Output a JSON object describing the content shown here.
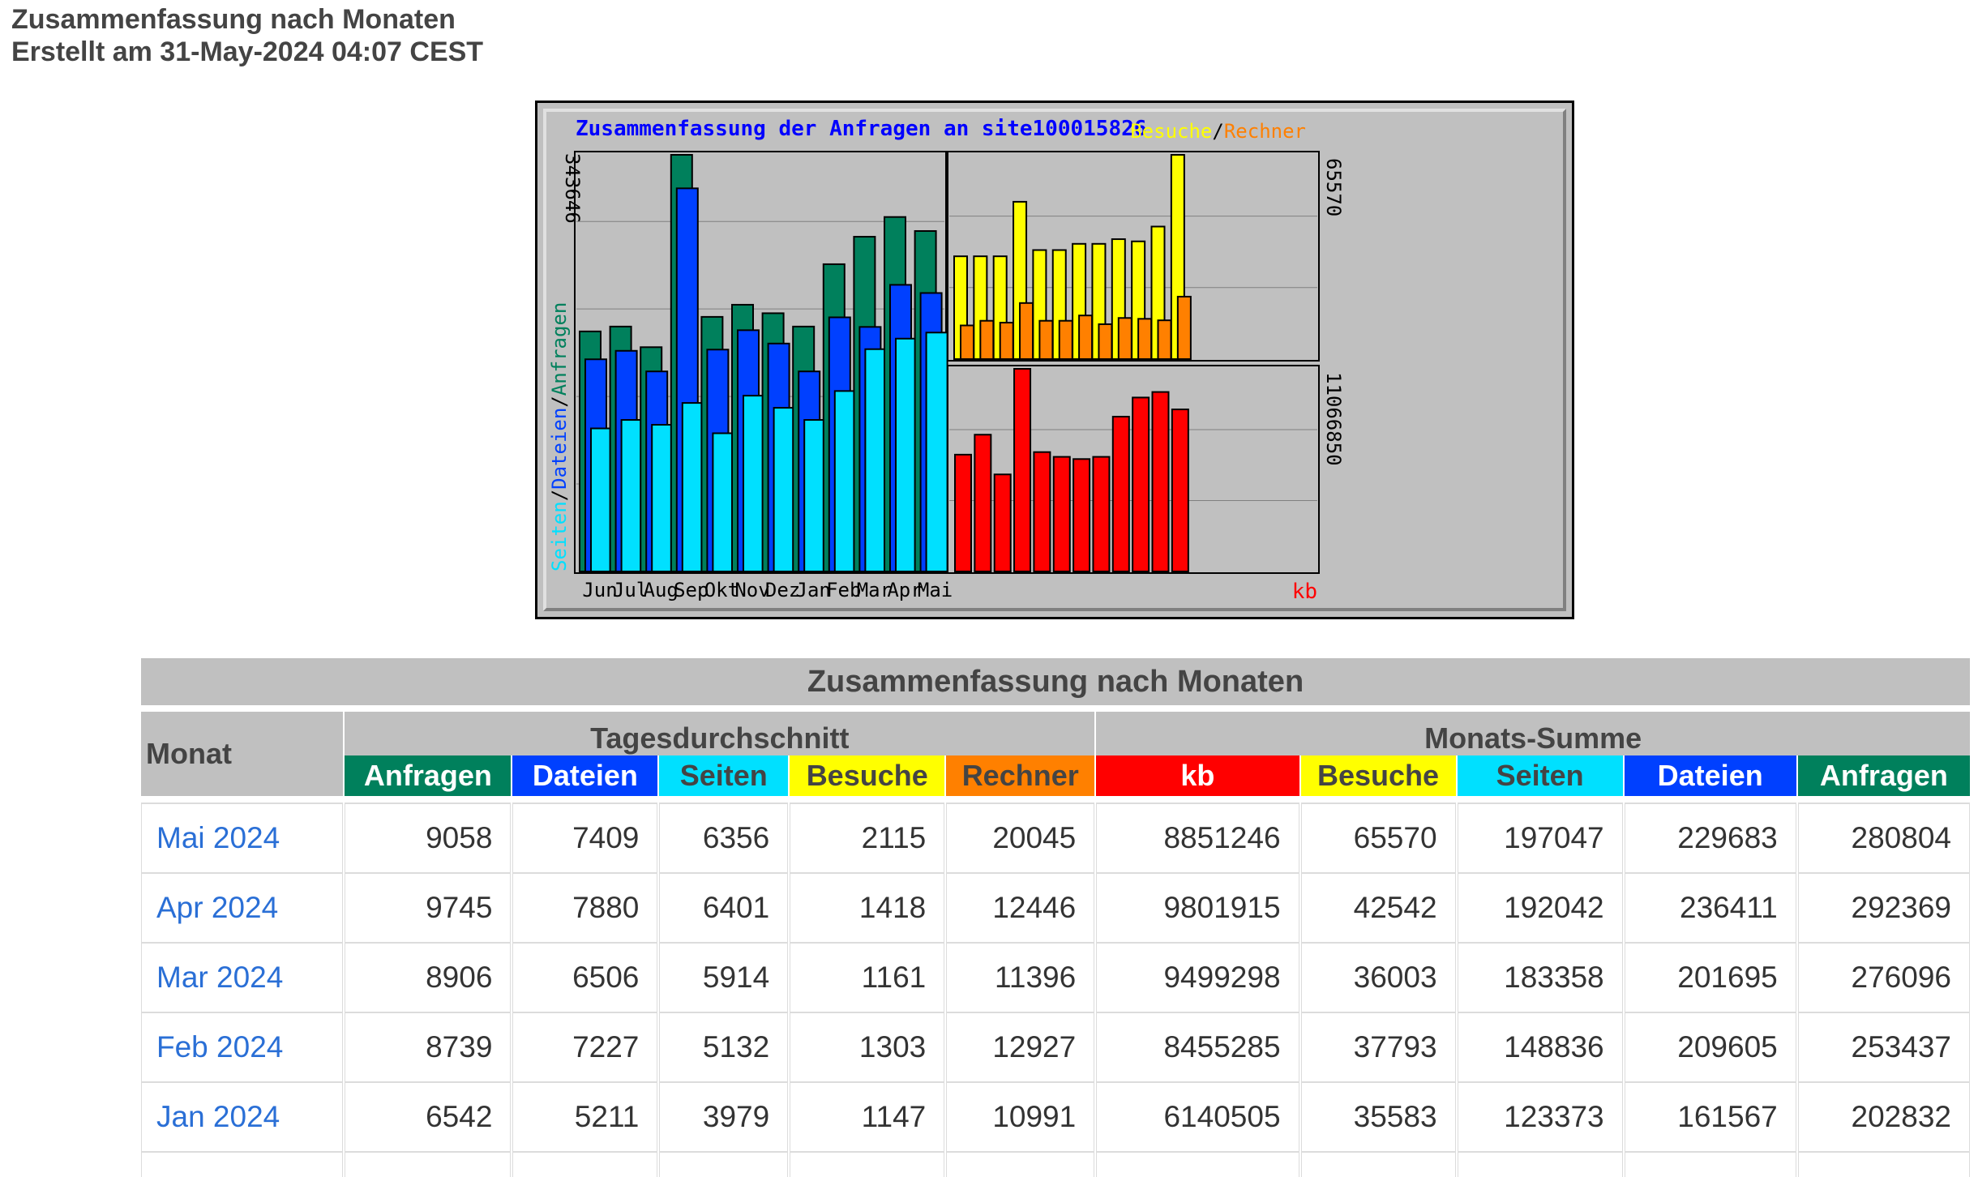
{
  "header": {
    "title": "Zusammenfassung nach Monaten",
    "generated": "Erstellt am 31-May-2024 04:07 CEST"
  },
  "colors": {
    "anfragen": "#00805c",
    "dateien": "#0040ff",
    "seiten": "#00e0ff",
    "besuche": "#ffff00",
    "rechner": "#ff8000",
    "kb": "#ff0000",
    "chart_bg": "#c0c0c0",
    "link": "#2a6fd6"
  },
  "chart_data": {
    "type": "bar",
    "title": "Zusammenfassung der Anfragen an site100015826",
    "categories": [
      "Jun",
      "Jul",
      "Aug",
      "Sep",
      "Okt",
      "Nov",
      "Dez",
      "Jan",
      "Feb",
      "Mar",
      "Apr",
      "Mai"
    ],
    "panels": [
      {
        "id": "requests",
        "max_label": "343646",
        "axis_label_parts": [
          "Seiten",
          "/",
          "Dateien",
          "/",
          "Anfragen"
        ],
        "ylim": [
          0,
          343646
        ],
        "series": [
          {
            "name": "Anfragen",
            "color": "#00805c",
            "values": [
              198000,
              202000,
              185000,
              343646,
              210000,
              220000,
              213000,
              202000,
              253437,
              276096,
              292369,
              280804
            ]
          },
          {
            "name": "Dateien",
            "color": "#0040ff",
            "values": [
              175000,
              182000,
              165000,
              316000,
              183000,
              199000,
              188000,
              165000,
              209605,
              201695,
              236411,
              229683
            ]
          },
          {
            "name": "Seiten",
            "color": "#00e0ff",
            "values": [
              118000,
              125000,
              121000,
              139000,
              114000,
              145000,
              135000,
              125000,
              148836,
              183358,
              192042,
              197047
            ]
          }
        ]
      },
      {
        "id": "visits",
        "max_label": "65570",
        "legend_parts": [
          "Besuche",
          "/",
          "Rechner"
        ],
        "ylim": [
          0,
          65570
        ],
        "series": [
          {
            "name": "Besuche",
            "color": "#ffff00",
            "values": [
              33000,
              33000,
              33000,
              50500,
              35000,
              35000,
              37000,
              37000,
              38500,
              37793,
              42542,
              65570
            ]
          },
          {
            "name": "Rechner",
            "color": "#ff8000",
            "values": [
              10800,
              12300,
              11700,
              18000,
              12300,
              12300,
              14000,
              11200,
              13200,
              12927,
              12446,
              20045
            ]
          }
        ]
      },
      {
        "id": "kb",
        "max_label": "11066850",
        "unit_label": "kb",
        "ylim": [
          0,
          11066850
        ],
        "series": [
          {
            "name": "kb",
            "color": "#ff0000",
            "values": [
              6380000,
              7470000,
              5300000,
              11066850,
              6520000,
              6260000,
              6140000,
              6260000,
              8455285,
              9499298,
              9801915,
              8851246
            ]
          }
        ]
      }
    ]
  },
  "table": {
    "title": "Zusammenfassung nach Monaten",
    "month_header": "Monat",
    "group_daily": "Tagesdurchschnitt",
    "group_monthly": "Monats-Summe",
    "columns": [
      "Anfragen",
      "Dateien",
      "Seiten",
      "Besuche",
      "Rechner",
      "kb",
      "Besuche",
      "Seiten",
      "Dateien",
      "Anfragen"
    ],
    "rows": [
      [
        "Mai 2024",
        "9058",
        "7409",
        "6356",
        "2115",
        "20045",
        "8851246",
        "65570",
        "197047",
        "229683",
        "280804"
      ],
      [
        "Apr 2024",
        "9745",
        "7880",
        "6401",
        "1418",
        "12446",
        "9801915",
        "42542",
        "192042",
        "236411",
        "292369"
      ],
      [
        "Mar 2024",
        "8906",
        "6506",
        "5914",
        "1161",
        "11396",
        "9499298",
        "36003",
        "183358",
        "201695",
        "276096"
      ],
      [
        "Feb 2024",
        "8739",
        "7227",
        "5132",
        "1303",
        "12927",
        "8455285",
        "37793",
        "148836",
        "209605",
        "253437"
      ],
      [
        "Jan 2024",
        "6542",
        "5211",
        "3979",
        "1147",
        "10991",
        "6140505",
        "35583",
        "123373",
        "161567",
        "202832"
      ]
    ]
  }
}
